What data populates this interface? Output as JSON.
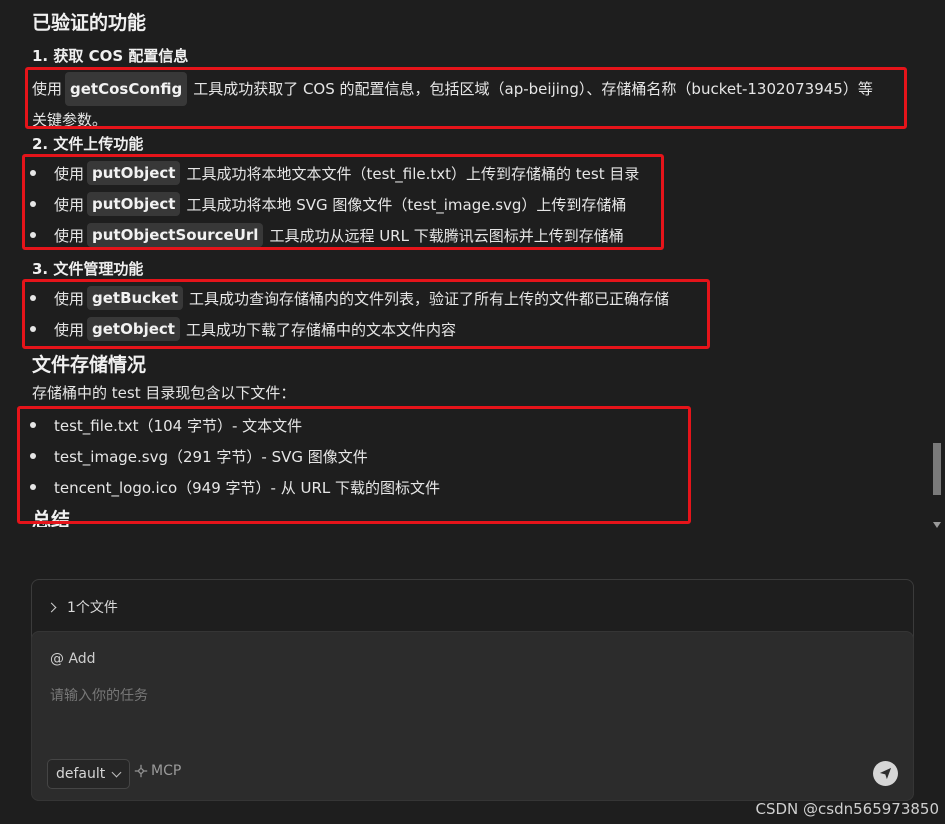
{
  "section_verified": {
    "title": "已验证的功能",
    "sub1": {
      "title": "1. 获取 COS 配置信息",
      "pre": "使用",
      "code": "getCosConfig",
      "line1_post": "工具成功获取了 COS 的配置信息，包括区域（ap-beijing）、存储桶名称（bucket-1302073945）等",
      "line2": "关键参数。"
    },
    "sub2": {
      "title": "2. 文件上传功能",
      "items": [
        {
          "pre": "使用",
          "code": "putObject",
          "post": "工具成功将本地文本文件（test_file.txt）上传到存储桶的 test 目录"
        },
        {
          "pre": "使用",
          "code": "putObject",
          "post": "工具成功将本地 SVG 图像文件（test_image.svg）上传到存储桶"
        },
        {
          "pre": "使用",
          "code": "putObjectSourceUrl",
          "post": "工具成功从远程 URL 下载腾讯云图标并上传到存储桶"
        }
      ]
    },
    "sub3": {
      "title": "3. 文件管理功能",
      "items": [
        {
          "pre": "使用",
          "code": "getBucket",
          "post": "工具成功查询存储桶内的文件列表，验证了所有上传的文件都已正确存储"
        },
        {
          "pre": "使用",
          "code": "getObject",
          "post": "工具成功下载了存储桶中的文本文件内容"
        }
      ]
    }
  },
  "section_storage": {
    "title": "文件存储情况",
    "intro": "存储桶中的 test 目录现包含以下文件：",
    "files": [
      "test_file.txt（104 字节）- 文本文件",
      "test_image.svg（291 字节）- SVG 图像文件",
      "tencent_logo.ico（949 字节）- 从 URL 下载的图标文件"
    ]
  },
  "section_summary": {
    "title": "总结"
  },
  "files_panel": {
    "label": "1个文件"
  },
  "input_panel": {
    "mention": "@ Add",
    "placeholder": "请输入你的任务",
    "mode": "default",
    "mcp": "MCP"
  },
  "watermark": "CSDN @csdn565973850",
  "colors": {
    "highlight_box": "#e5141a",
    "background": "#1e1e1e",
    "code_bg": "#383838"
  },
  "icons": {
    "bullet": "disc",
    "files_toggle": "chevron-right-icon",
    "mode_dropdown": "chevron-down-icon",
    "mcp": "plug-icon",
    "send": "send-icon"
  }
}
